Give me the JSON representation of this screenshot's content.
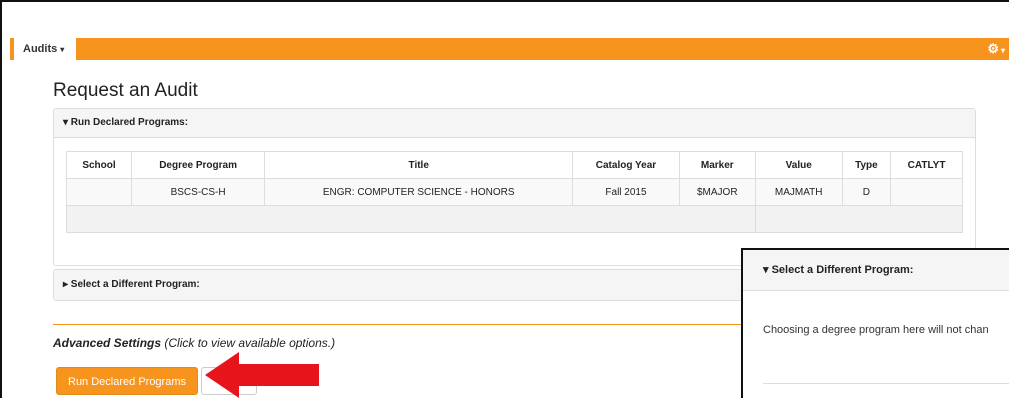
{
  "nav": {
    "audits_label": "Audits",
    "caret": "▾",
    "settings_icon": "⚙"
  },
  "page": {
    "title": "Request an Audit"
  },
  "declared": {
    "heading": "▾ Run Declared Programs:",
    "columns": [
      "School",
      "Degree Program",
      "Title",
      "Catalog Year",
      "Marker",
      "Value",
      "Type",
      "CATLYT"
    ],
    "rows": [
      [
        "",
        "BSCS-CS-H",
        "ENGR: COMPUTER SCIENCE - HONORS",
        "Fall 2015",
        "$MAJOR",
        "MAJMATH",
        "D",
        ""
      ]
    ]
  },
  "different": {
    "heading": "▸ Select a Different Program:"
  },
  "advanced": {
    "label": "Advanced Settings",
    "hint": " (Click to view available options.)"
  },
  "buttons": {
    "run_declared": "Run Declared Programs"
  },
  "zoom": {
    "heading": "▾ Select a Different Program:",
    "text": "Choosing a degree program here will not chan"
  },
  "colors": {
    "accent": "#f7941d",
    "annotation_arrow": "#e8141b"
  }
}
